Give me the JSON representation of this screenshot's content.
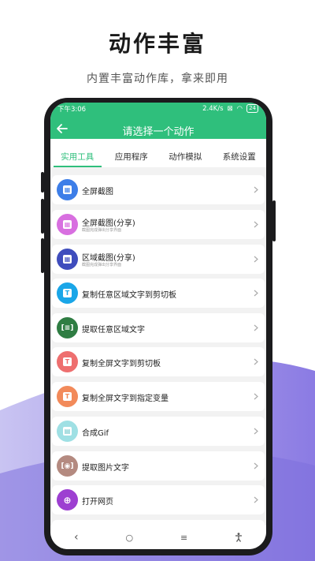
{
  "promo": {
    "title": "动作丰富",
    "subtitle": "内置丰富动作库，拿来即用"
  },
  "status_bar": {
    "time": "下午3:06",
    "speed": "2.4K/s",
    "battery": "24"
  },
  "header": {
    "title": "请选择一个动作"
  },
  "tabs": [
    {
      "label": "实用工具",
      "active": true
    },
    {
      "label": "应用程序",
      "active": false
    },
    {
      "label": "动作模拟",
      "active": false
    },
    {
      "label": "系统设置",
      "active": false
    }
  ],
  "items": [
    {
      "label": "全屏截图",
      "desc": "",
      "icon": "screenshot-icon",
      "color": "#3d7ee8"
    },
    {
      "label": "全屏截图(分享)",
      "desc": "截图完成弹出分享界面",
      "icon": "screenshot-share-icon",
      "color": "#d86fe0"
    },
    {
      "label": "区域截图(分享)",
      "desc": "截图完成弹出分享界面",
      "icon": "region-screenshot-icon",
      "color": "#3f4dbd"
    },
    {
      "label": "复制任意区域文字到剪切板",
      "desc": "",
      "icon": "copy-text-icon",
      "color": "#1aa6e8"
    },
    {
      "label": "提取任意区域文字",
      "desc": "",
      "icon": "extract-text-icon",
      "color": "#2f7d43"
    },
    {
      "label": "复制全屏文字到剪切板",
      "desc": "",
      "icon": "copy-text-icon",
      "color": "#ee6f6f"
    },
    {
      "label": "复制全屏文字到指定变量",
      "desc": "",
      "icon": "copy-text-icon",
      "color": "#f28a5a"
    },
    {
      "label": "合成Gif",
      "desc": "",
      "icon": "gif-icon",
      "color": "#9fe0e4"
    },
    {
      "label": "提取图片文字",
      "desc": "",
      "icon": "scan-icon",
      "color": "#b48a80"
    },
    {
      "label": "打开网页",
      "desc": "",
      "icon": "globe-icon",
      "color": "#9d3fd1"
    }
  ],
  "nav": {
    "back": "‹",
    "home": "○",
    "menu": "≡",
    "accessibility": "accessibility-icon"
  }
}
